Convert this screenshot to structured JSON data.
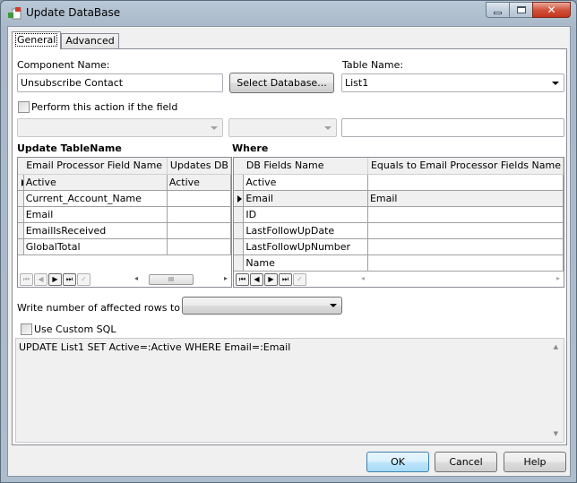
{
  "window": {
    "title": "Update DataBase",
    "app_icon": "database-update-icon",
    "controls": {
      "minimize": "minimize-icon",
      "maximize": "maximize-icon",
      "close": "close-icon"
    }
  },
  "tabs": [
    {
      "label": "General",
      "active": true
    },
    {
      "label": "Advanced",
      "active": false
    }
  ],
  "general": {
    "component_name_label": "Component Name:",
    "component_name_value": "Unsubscribe Contact",
    "select_database_label": "Select Database...",
    "table_name_label": "Table Name:",
    "table_name_value": "List1",
    "perform_action_label": "Perform this action if the field",
    "perform_action_checked": false,
    "condition_field_value": "",
    "condition_operator_value": "",
    "condition_value": "",
    "update_section_title": "Update TableName",
    "update_grid": {
      "columns": [
        "Email Processor Field Name",
        "Updates DB"
      ],
      "rows": [
        {
          "field": "Active",
          "updates": "Active",
          "current": true
        },
        {
          "field": "Current_Account_Name",
          "updates": "",
          "current": false
        },
        {
          "field": "Email",
          "updates": "",
          "current": false
        },
        {
          "field": "EmailIsReceived",
          "updates": "",
          "current": false
        },
        {
          "field": "GlobalTotal",
          "updates": "",
          "current": false
        }
      ]
    },
    "where_section_title": "Where",
    "where_grid": {
      "columns": [
        "DB Fields Name",
        "Equals to Email Processor Fields Name"
      ],
      "rows": [
        {
          "field": "Active",
          "equals": "",
          "current": false
        },
        {
          "field": "Email",
          "equals": "Email",
          "current": true
        },
        {
          "field": "ID",
          "equals": "",
          "current": false
        },
        {
          "field": "LastFollowUpDate",
          "equals": "",
          "current": false
        },
        {
          "field": "LastFollowUpNumber",
          "equals": "",
          "current": false
        },
        {
          "field": "Name",
          "equals": "",
          "current": false
        }
      ]
    },
    "navigator": {
      "first": "first-record-icon",
      "prior": "prior-record-icon",
      "next": "next-record-icon",
      "last": "last-record-icon",
      "post": "post-checkmark-icon"
    },
    "write_rows_label": "Write number of affected rows to the:",
    "write_rows_value": "",
    "use_custom_sql_label": "Use Custom SQL",
    "use_custom_sql_checked": false,
    "sql_text": "UPDATE List1 SET Active=:Active WHERE Email=:Email"
  },
  "buttons": {
    "ok": "OK",
    "cancel": "Cancel",
    "help": "Help"
  }
}
